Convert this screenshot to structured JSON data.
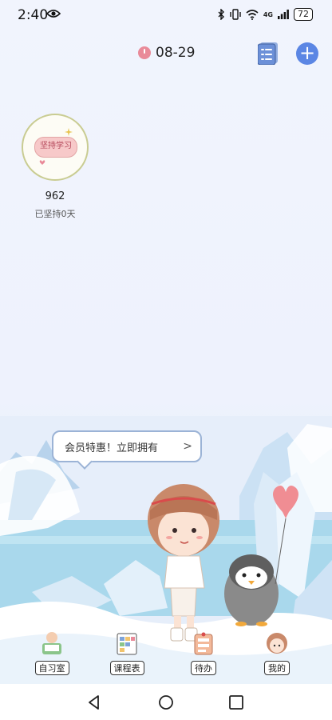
{
  "status_bar": {
    "time": "2:40",
    "signal_text": "4G",
    "battery": "72"
  },
  "header": {
    "date": "08-29"
  },
  "goal": {
    "sticker_text": "坚持学习",
    "count": "962",
    "streak": "已坚持0天"
  },
  "promo": {
    "text": "会员特惠！立即拥有",
    "arrow": ">"
  },
  "bottom_nav": {
    "items": [
      {
        "label": "自习室",
        "icon": "study-room-icon"
      },
      {
        "label": "课程表",
        "icon": "schedule-icon"
      },
      {
        "label": "待办",
        "icon": "todo-icon"
      },
      {
        "label": "我的",
        "icon": "profile-icon"
      }
    ]
  },
  "colors": {
    "accent": "#5b86e4",
    "clock": "#e98a99",
    "background": "#f1f4fd"
  }
}
